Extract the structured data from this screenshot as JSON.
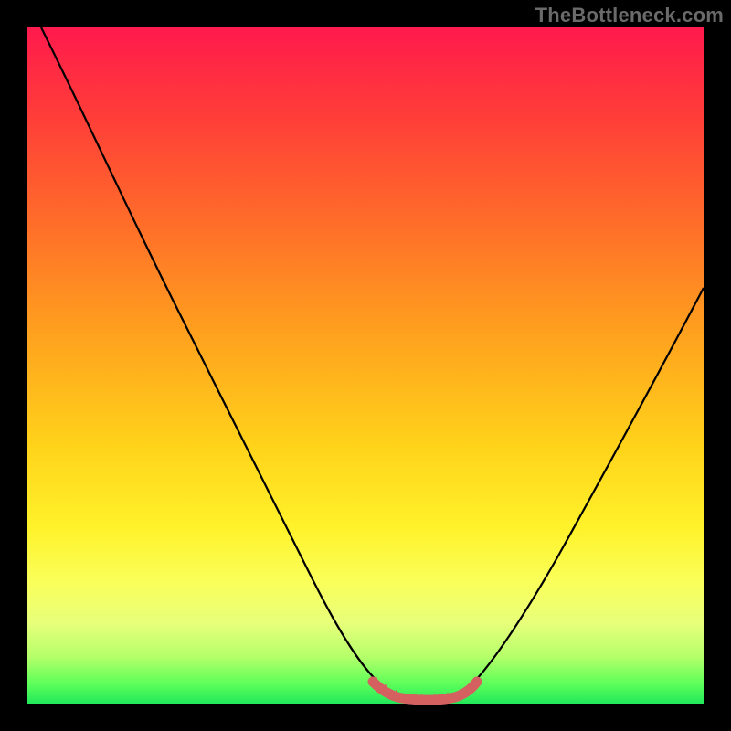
{
  "watermark": {
    "text": "TheBottleneck.com"
  },
  "chart_data": {
    "type": "line",
    "title": "",
    "xlabel": "",
    "ylabel": "",
    "xlim": [
      0,
      100
    ],
    "ylim": [
      0,
      100
    ],
    "grid": false,
    "legend": false,
    "series": [
      {
        "name": "bottleneck-curve",
        "color": "#000000",
        "x": [
          0,
          6,
          12,
          18,
          24,
          30,
          36,
          42,
          48,
          52,
          55,
          58,
          60,
          64,
          70,
          76,
          82,
          88,
          94,
          100
        ],
        "values": [
          100,
          90,
          79,
          68,
          56,
          45,
          34,
          23,
          12,
          5,
          1,
          0,
          0,
          1,
          8,
          18,
          29,
          40,
          51,
          62
        ]
      },
      {
        "name": "flat-region-highlight",
        "color": "#d46060",
        "x": [
          52,
          55,
          58,
          60,
          62,
          64
        ],
        "values": [
          3,
          1,
          0.5,
          0.5,
          1,
          2
        ]
      }
    ],
    "annotations": []
  },
  "colors": {
    "background_gradient_top": "#ff1a4d",
    "background_gradient_mid": "#ffd31a",
    "background_gradient_bottom": "#21e85a",
    "curve": "#000000",
    "highlight": "#d46060",
    "frame": "#000000"
  }
}
